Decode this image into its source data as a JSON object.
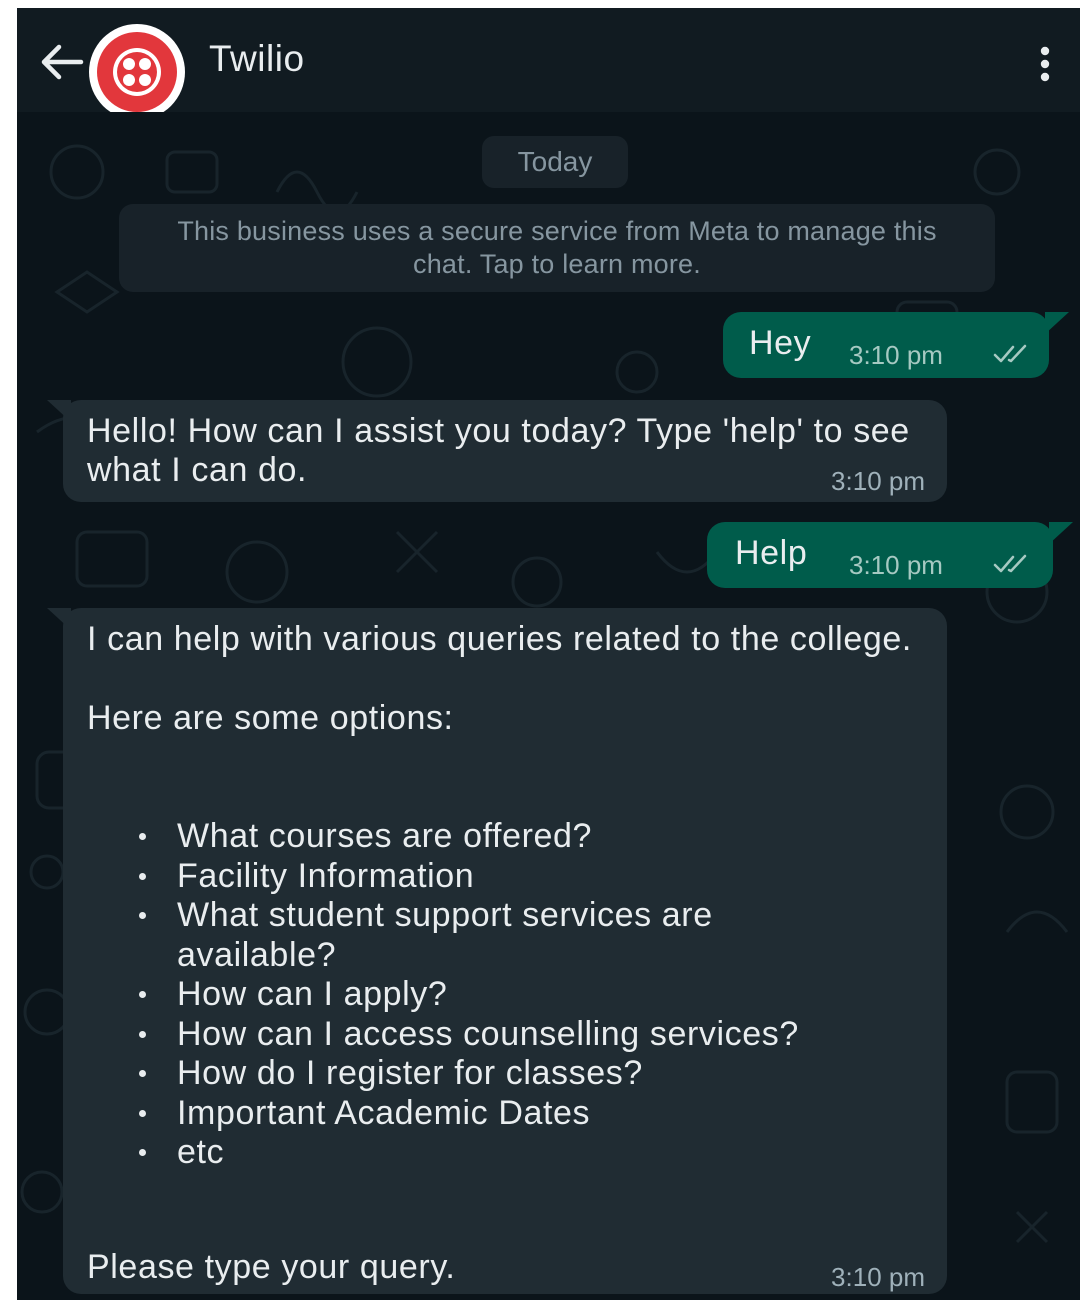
{
  "header": {
    "contact_name": "Twilio",
    "back_icon": "arrow-left-icon",
    "menu_icon": "more-vertical-icon",
    "avatar_icon": "twilio-logo-icon",
    "avatar_color": "#e2373c"
  },
  "chat": {
    "date_label": "Today",
    "business_notice": "This business uses a secure service from Meta to manage this chat. Tap to learn more.",
    "messages": [
      {
        "direction": "outgoing",
        "text": "Hey",
        "time": "3:10 pm",
        "status_icon": "double-check-icon"
      },
      {
        "direction": "incoming",
        "text": "Hello! How can I assist you today? Type 'help' to see what I can do.",
        "time": "3:10 pm"
      },
      {
        "direction": "outgoing",
        "text": "Help",
        "time": "3:10 pm",
        "status_icon": "double-check-icon"
      },
      {
        "direction": "incoming",
        "intro_line1": "I can help with various queries related to the college.",
        "intro_line2": "Here are some options:",
        "options": [
          "What courses are offered?",
          "Facility Information",
          "What student support services are available?",
          "How can I apply?",
          "How can I access counselling services?",
          "How do I register for classes?",
          "Important Academic Dates",
          "etc"
        ],
        "closing": "Please type your query.",
        "time": "3:10 pm"
      }
    ]
  },
  "colors": {
    "background": "#0b141a",
    "header": "#111b21",
    "outgoing_bubble": "#005c4b",
    "incoming_bubble": "#202c33",
    "text": "#e9edef",
    "muted_text": "#8696a0"
  }
}
